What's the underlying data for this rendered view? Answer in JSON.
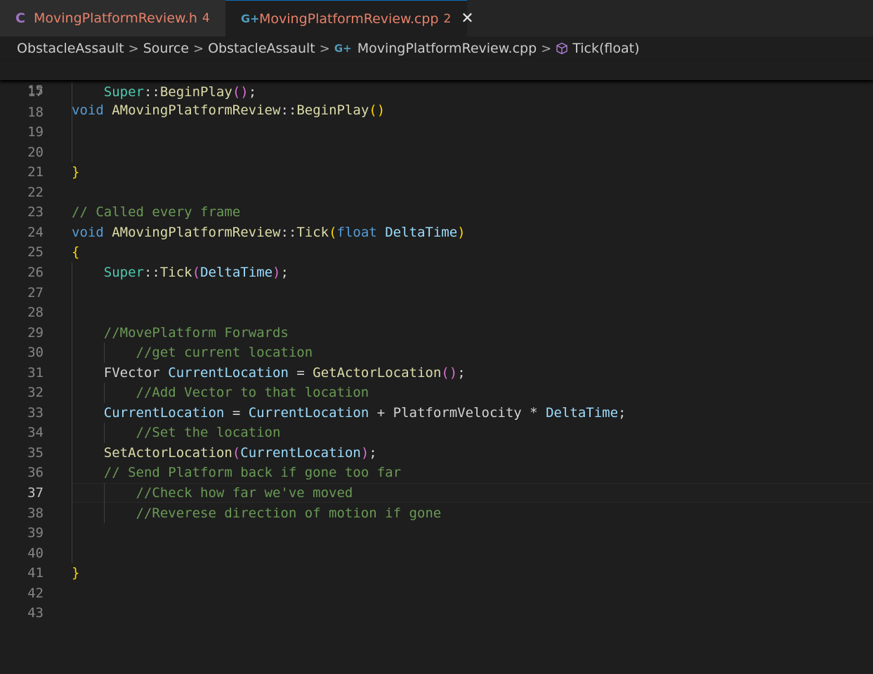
{
  "tabs": [
    {
      "icon": "C",
      "name": "MovingPlatformReview.h",
      "problems": "4",
      "active": false
    },
    {
      "icon": "G+",
      "name": "MovingPlatformReview.cpp",
      "problems": "2",
      "active": true,
      "close": "✕"
    }
  ],
  "breadcrumb": {
    "items": [
      "ObstacleAssault",
      "Source",
      "ObstacleAssault",
      "MovingPlatformReview.cpp",
      "Tick(float)"
    ],
    "separator": ">"
  },
  "editor": {
    "current_line": "37",
    "sticky_line": {
      "number": "15",
      "code": "void AMovingPlatformReview::BeginPlay()"
    },
    "lines": [
      {
        "n": "17",
        "code": "    Super::BeginPlay();"
      },
      {
        "n": "18",
        "code": ""
      },
      {
        "n": "19",
        "code": ""
      },
      {
        "n": "20",
        "code": ""
      },
      {
        "n": "21",
        "code": "}"
      },
      {
        "n": "22",
        "code": ""
      },
      {
        "n": "23",
        "code": "// Called every frame"
      },
      {
        "n": "24",
        "code": "void AMovingPlatformReview::Tick(float DeltaTime)"
      },
      {
        "n": "25",
        "code": "{"
      },
      {
        "n": "26",
        "code": "    Super::Tick(DeltaTime);"
      },
      {
        "n": "27",
        "code": ""
      },
      {
        "n": "28",
        "code": ""
      },
      {
        "n": "29",
        "code": "    //MovePlatform Forwards"
      },
      {
        "n": "30",
        "code": "        //get current location"
      },
      {
        "n": "31",
        "code": "    FVector CurrentLocation = GetActorLocation();"
      },
      {
        "n": "32",
        "code": "        //Add Vector to that location"
      },
      {
        "n": "33",
        "code": "    CurrentLocation = CurrentLocation + PlatformVelocity * DeltaTime;"
      },
      {
        "n": "34",
        "code": "        //Set the location"
      },
      {
        "n": "35",
        "code": "    SetActorLocation(CurrentLocation);"
      },
      {
        "n": "36",
        "code": "    // Send Platform back if gone too far"
      },
      {
        "n": "37",
        "code": "        //Check how far we've moved"
      },
      {
        "n": "38",
        "code": "        //Reverese direction of motion if gone"
      },
      {
        "n": "39",
        "code": ""
      },
      {
        "n": "40",
        "code": ""
      },
      {
        "n": "41",
        "code": "}"
      },
      {
        "n": "42",
        "code": ""
      },
      {
        "n": "43",
        "code": ""
      }
    ]
  },
  "colors": {
    "background": "#1e1e1e",
    "tab_active_border": "#0e70c0",
    "tab_label": "#e8816a",
    "keyword": "#569cd6",
    "function": "#dcdcaa",
    "type": "#4ec9b0",
    "variable": "#9cdcfe",
    "comment": "#6a9955"
  }
}
